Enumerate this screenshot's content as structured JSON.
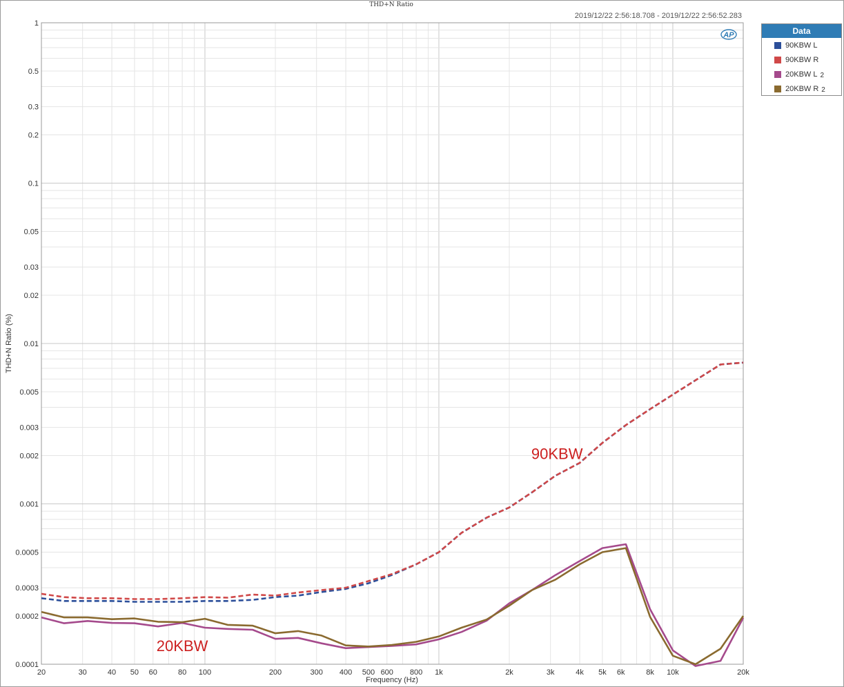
{
  "chart_data": {
    "type": "line",
    "title": "THD+N Ratio",
    "timestamp": "2019/12/22 2:56:18.708 - 2019/12/22 2:56:52.283",
    "xlabel": "Frequency (Hz)",
    "ylabel": "THD+N Ratio (%)",
    "xscale": "log",
    "yscale": "log",
    "xlim": [
      20,
      20000
    ],
    "ylim": [
      0.0001,
      1
    ],
    "grid": true,
    "x_ticks": [
      {
        "v": 20,
        "label": "20"
      },
      {
        "v": 30,
        "label": "30"
      },
      {
        "v": 40,
        "label": "40"
      },
      {
        "v": 50,
        "label": "50"
      },
      {
        "v": 60,
        "label": "60"
      },
      {
        "v": 80,
        "label": "80"
      },
      {
        "v": 100,
        "label": "100"
      },
      {
        "v": 200,
        "label": "200"
      },
      {
        "v": 300,
        "label": "300"
      },
      {
        "v": 400,
        "label": "400"
      },
      {
        "v": 500,
        "label": "500"
      },
      {
        "v": 600,
        "label": "600"
      },
      {
        "v": 800,
        "label": "800"
      },
      {
        "v": 1000,
        "label": "1k"
      },
      {
        "v": 2000,
        "label": "2k"
      },
      {
        "v": 3000,
        "label": "3k"
      },
      {
        "v": 4000,
        "label": "4k"
      },
      {
        "v": 5000,
        "label": "5k"
      },
      {
        "v": 6000,
        "label": "6k"
      },
      {
        "v": 8000,
        "label": "8k"
      },
      {
        "v": 10000,
        "label": "10k"
      },
      {
        "v": 20000,
        "label": "20k"
      }
    ],
    "y_ticks": [
      {
        "v": 1,
        "label": "1"
      },
      {
        "v": 0.5,
        "label": "0.5"
      },
      {
        "v": 0.3,
        "label": "0.3"
      },
      {
        "v": 0.2,
        "label": "0.2"
      },
      {
        "v": 0.1,
        "label": "0.1"
      },
      {
        "v": 0.05,
        "label": "0.05"
      },
      {
        "v": 0.03,
        "label": "0.03"
      },
      {
        "v": 0.02,
        "label": "0.02"
      },
      {
        "v": 0.01,
        "label": "0.01"
      },
      {
        "v": 0.005,
        "label": "0.005"
      },
      {
        "v": 0.003,
        "label": "0.003"
      },
      {
        "v": 0.002,
        "label": "0.002"
      },
      {
        "v": 0.001,
        "label": "0.001"
      },
      {
        "v": 0.0005,
        "label": "0.0005"
      },
      {
        "v": 0.0003,
        "label": "0.0003"
      },
      {
        "v": 0.0002,
        "label": "0.0002"
      },
      {
        "v": 0.0001,
        "label": "0.0001"
      }
    ],
    "x": [
      20,
      25,
      31.5,
      40,
      50,
      63,
      80,
      100,
      125,
      160,
      200,
      250,
      315,
      400,
      500,
      630,
      800,
      1000,
      1250,
      1600,
      2000,
      2500,
      3150,
      4000,
      5000,
      6300,
      8000,
      10000,
      12500,
      16000,
      20000
    ],
    "series": [
      {
        "name": "90KBW L",
        "color": "#2c4f9a",
        "dash": true,
        "values": [
          0.000258,
          0.000248,
          0.000248,
          0.000248,
          0.000245,
          0.000245,
          0.000245,
          0.000248,
          0.000248,
          0.000252,
          0.000262,
          0.000268,
          0.000282,
          0.000295,
          0.00032,
          0.00036,
          0.00042,
          0.0005,
          0.00066,
          0.00082,
          0.00095,
          0.00118,
          0.0015,
          0.0018,
          0.0024,
          0.0031,
          0.0039,
          0.0048,
          0.0059,
          0.0074,
          0.0076
        ]
      },
      {
        "name": "90KBW R",
        "color": "#d04848",
        "dash": true,
        "values": [
          0.000275,
          0.000262,
          0.000258,
          0.000258,
          0.000255,
          0.000255,
          0.000258,
          0.000262,
          0.00026,
          0.000272,
          0.000268,
          0.00028,
          0.00029,
          0.0003,
          0.00033,
          0.000365,
          0.00042,
          0.0005,
          0.00066,
          0.00082,
          0.00095,
          0.00118,
          0.0015,
          0.0018,
          0.0024,
          0.0031,
          0.0039,
          0.0048,
          0.0059,
          0.0074,
          0.0076
        ]
      },
      {
        "name": "20KBW L",
        "suffix": "2",
        "color": "#a54a8c",
        "dash": false,
        "values": [
          0.000196,
          0.00018,
          0.000186,
          0.000181,
          0.00018,
          0.000172,
          0.000181,
          0.000169,
          0.000166,
          0.000164,
          0.000144,
          0.000146,
          0.000135,
          0.000126,
          0.000128,
          0.00013,
          0.000133,
          0.000143,
          0.000159,
          0.000187,
          0.00024,
          0.00029,
          0.00036,
          0.00044,
          0.00053,
          0.00056,
          0.00022,
          0.000122,
          9.75e-05,
          0.000105,
          0.000195
        ]
      },
      {
        "name": "20KBW R",
        "suffix": "2",
        "color": "#8a6a2f",
        "dash": false,
        "values": [
          0.000212,
          0.000196,
          0.000196,
          0.000191,
          0.000193,
          0.000184,
          0.000183,
          0.000192,
          0.000176,
          0.000174,
          0.000156,
          0.000161,
          0.000151,
          0.000131,
          0.000129,
          0.000132,
          0.000138,
          0.000149,
          0.000169,
          0.00019,
          0.000232,
          0.00029,
          0.000337,
          0.00042,
          0.0005,
          0.00053,
          0.000197,
          0.000113,
          0.0001,
          0.000125,
          0.0002
        ]
      }
    ],
    "annotations": [
      {
        "text": "90KBW",
        "x": 3200,
        "y": 0.0019,
        "color": "#cc1f1f"
      },
      {
        "text": "20KBW",
        "x": 80,
        "y": 0.000121,
        "color": "#cc1f1f"
      }
    ],
    "legend": {
      "title": "Data",
      "position": "right"
    },
    "logo_text": "AP"
  }
}
